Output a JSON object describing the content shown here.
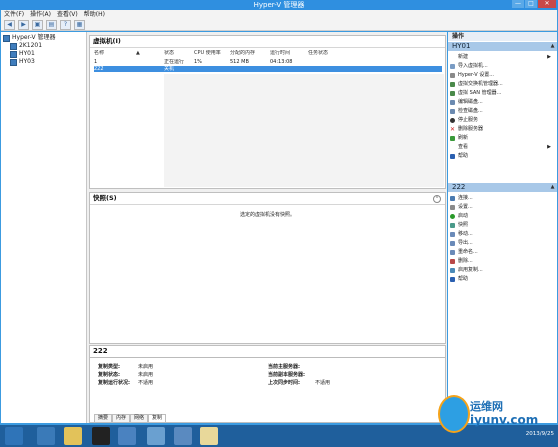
{
  "title": "Hyper-V 管理器",
  "window_buttons": {
    "minimize": "—",
    "maximize": "□",
    "close": "✕"
  },
  "menu": [
    "文件(F)",
    "操作(A)",
    "查看(V)",
    "帮助(H)"
  ],
  "toolbar_icons": [
    "back-icon",
    "forward-icon",
    "up-folder-icon",
    "show-hide-tree-icon",
    "help-icon",
    "properties-icon"
  ],
  "tree": {
    "root": "Hyper-V 管理器",
    "children": [
      "2K1201",
      "HY01",
      "HY03"
    ]
  },
  "vm_panel": {
    "title": "虚拟机(I)",
    "columns": [
      "名称",
      "状态",
      "CPU 使用率",
      "分配的内存",
      "运行时间",
      "任务状态"
    ],
    "rows": [
      {
        "name": "1",
        "state": "正在运行",
        "cpu": "1%",
        "mem": "512 MB",
        "uptime": "04:13:08",
        "task": ""
      },
      {
        "name": "222",
        "state": "关机",
        "cpu": "",
        "mem": "",
        "uptime": "",
        "task": ""
      }
    ]
  },
  "snapshot_panel": {
    "title": "快照(S)",
    "empty_text": "选定的虚拟机没有快照。"
  },
  "details_panel": {
    "title": "222",
    "left_fields": [
      {
        "label": "复制类型:",
        "value": "未启用"
      },
      {
        "label": "复制状态:",
        "value": "未启用"
      },
      {
        "label": "复制运行状况:",
        "value": "不适用"
      }
    ],
    "right_fields": [
      {
        "label": "当前主服务器:",
        "value": ""
      },
      {
        "label": "当前副本服务器:",
        "value": ""
      },
      {
        "label": "上次同步时间:",
        "value": "不适用"
      }
    ],
    "tabs": [
      "摘要",
      "内存",
      "网络",
      "复制"
    ]
  },
  "actions_panel": {
    "header": "操作",
    "section1": "HY01",
    "items1": [
      "新建",
      "导入虚拟机...",
      "Hyper-V 设置...",
      "虚拟交换机管理器...",
      "虚拟 SAN 管理器...",
      "编辑磁盘...",
      "检查磁盘...",
      "停止服务",
      "删除服务器",
      "刷新",
      "查看",
      "帮助"
    ],
    "section2": "222",
    "items2": [
      "连接...",
      "设置...",
      "启动",
      "快照",
      "移动...",
      "导出...",
      "重命名...",
      "删除...",
      "启用复制...",
      "帮助"
    ]
  },
  "taskbar": {
    "clock_time": "",
    "clock_date": "2013/9/25"
  },
  "watermark": {
    "brand": "运维网",
    "site": "iyunv.com"
  }
}
